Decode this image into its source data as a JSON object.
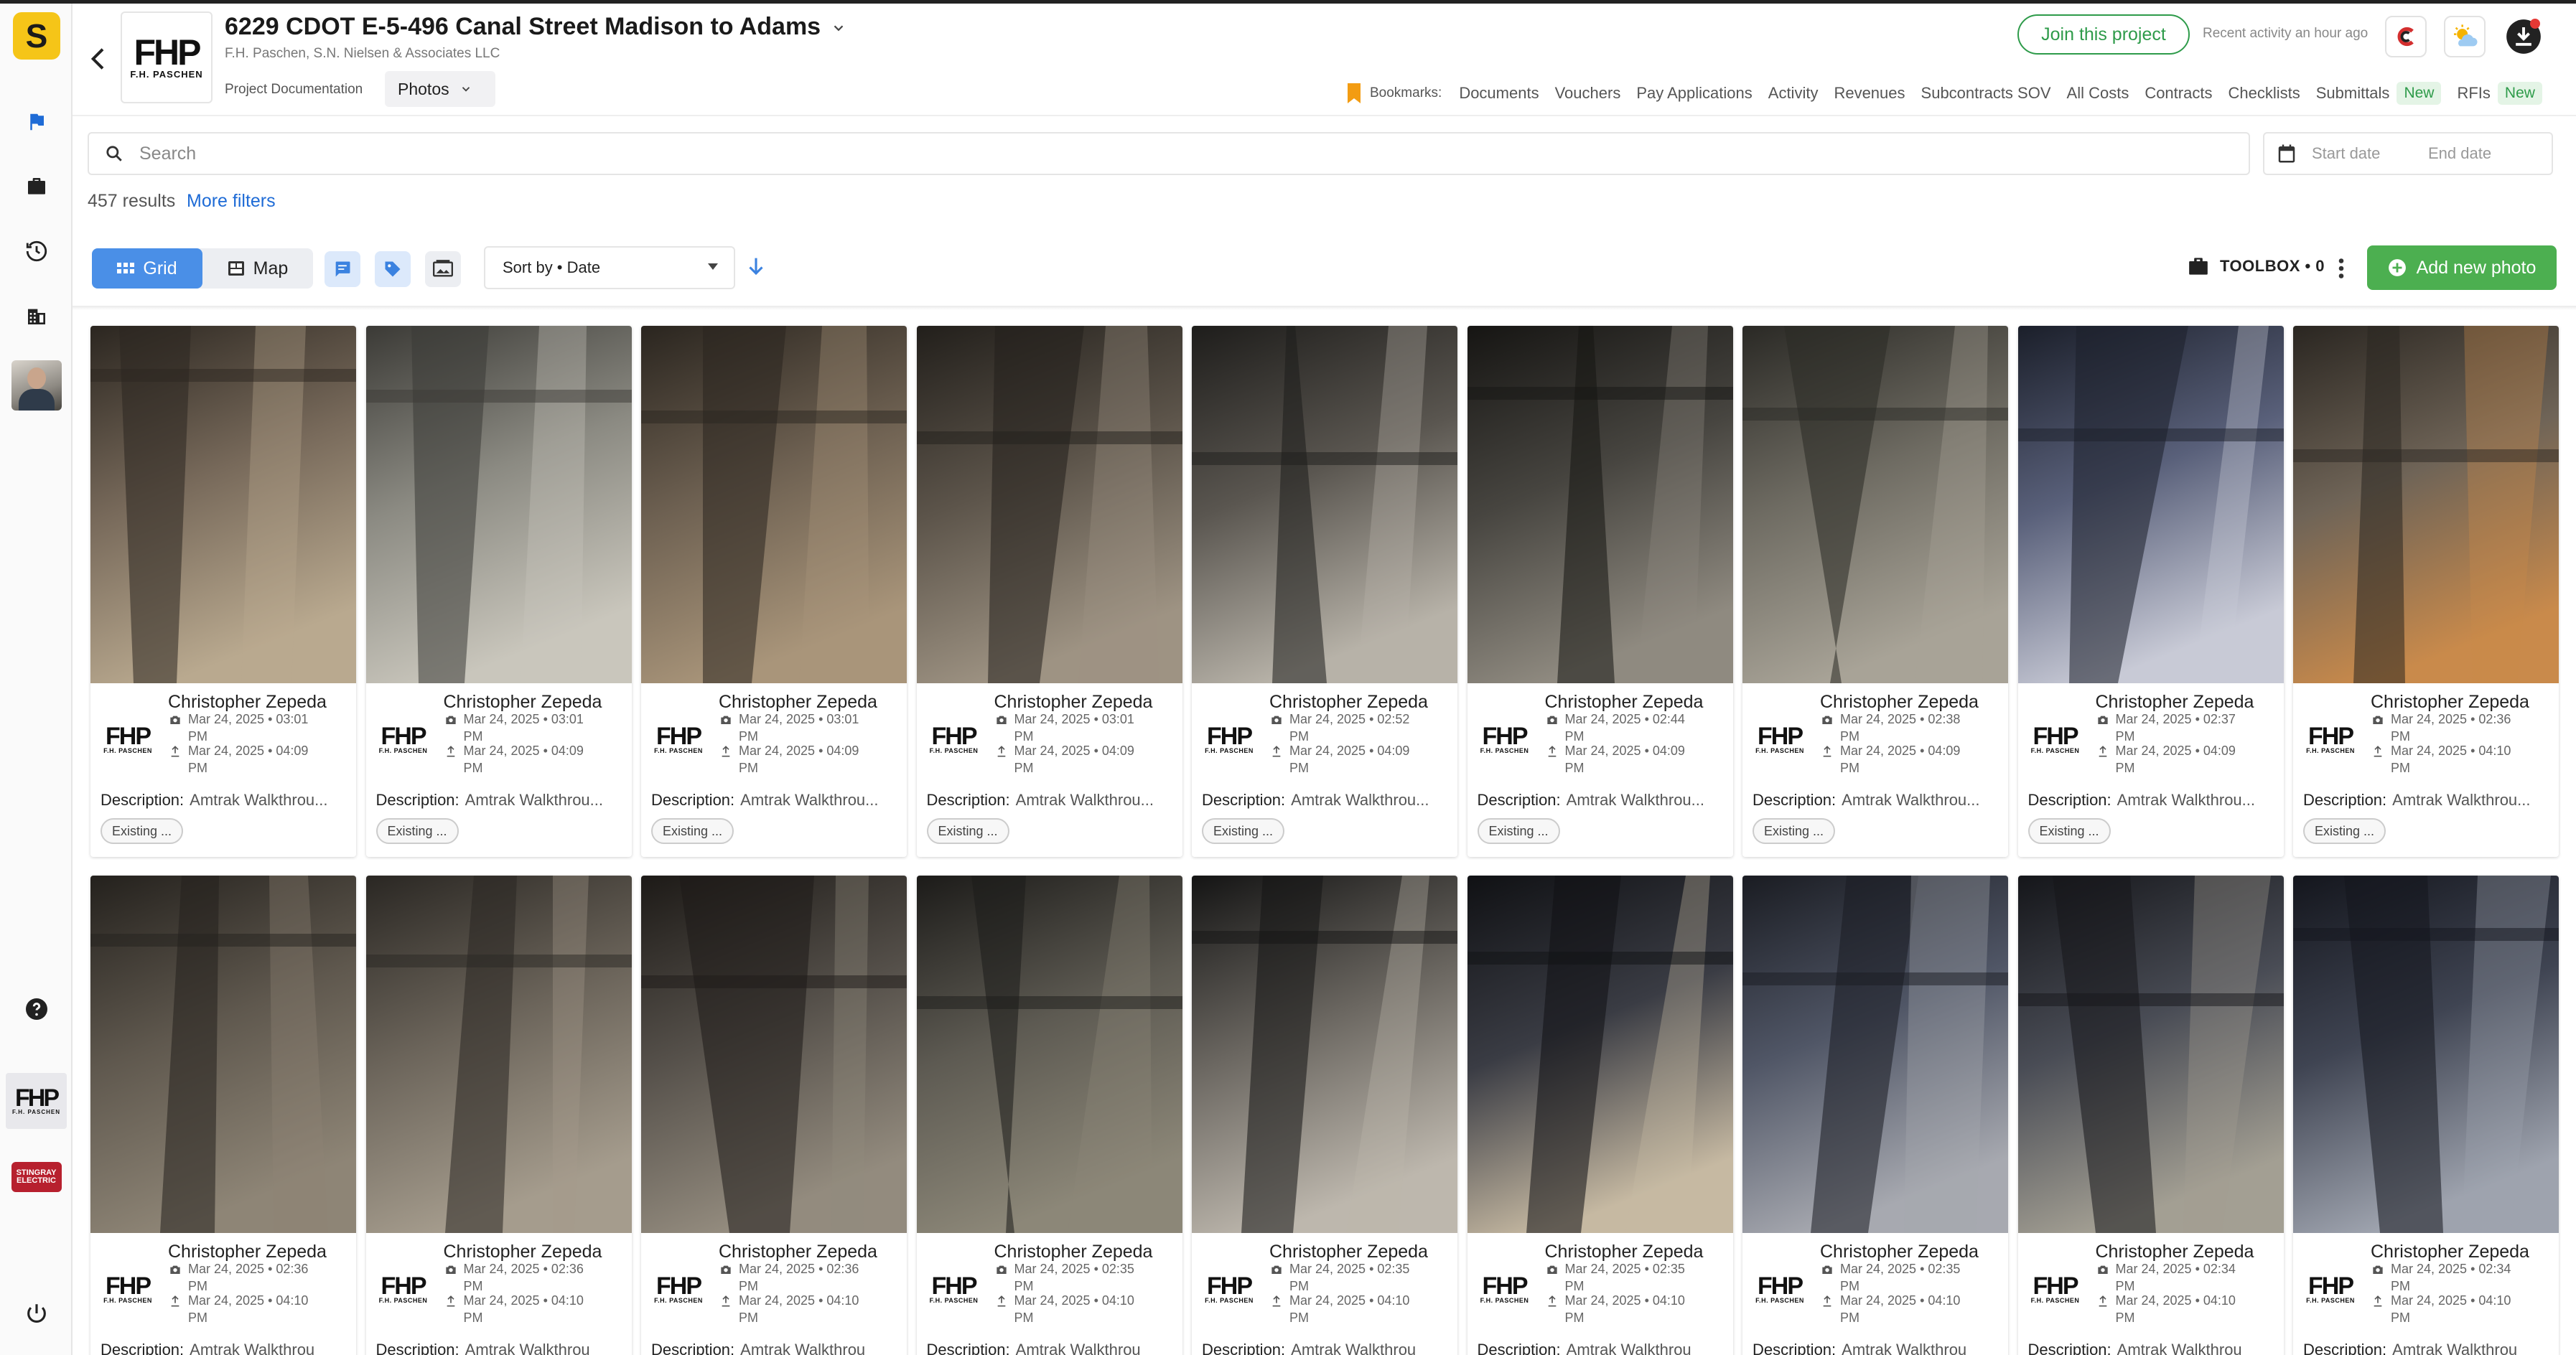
{
  "app": {
    "logo_letter": "S"
  },
  "project": {
    "title": "6229 CDOT E-5-496 Canal Street Madison to Adams",
    "subtitle": "F.H. Paschen, S.N. Nielsen & Associates LLC",
    "section": "Project Documentation",
    "view": "Photos",
    "logo_text": "FHP",
    "logo_sub": "F.H. PASCHEN"
  },
  "header": {
    "join_label": "Join this project",
    "recent_activity": "Recent activity an hour ago",
    "bookmarks_label": "Bookmarks:",
    "bookmarks": [
      {
        "label": "Documents"
      },
      {
        "label": "Vouchers"
      },
      {
        "label": "Pay Applications"
      },
      {
        "label": "Activity"
      },
      {
        "label": "Revenues"
      },
      {
        "label": "Subcontracts SOV"
      },
      {
        "label": "All Costs"
      },
      {
        "label": "Contracts"
      },
      {
        "label": "Checklists"
      },
      {
        "label": "Submittals",
        "badge": "New"
      },
      {
        "label": "RFIs",
        "badge": "New"
      }
    ]
  },
  "sidebar": {
    "items": [
      {
        "icon": "flag-icon"
      },
      {
        "icon": "briefcase-icon"
      },
      {
        "icon": "history-icon"
      },
      {
        "icon": "building-icon"
      },
      {
        "icon": "help-icon"
      },
      {
        "icon": "power-icon"
      }
    ],
    "company_stingray": "STINGRAY ELECTRIC"
  },
  "search": {
    "placeholder": "Search",
    "start_placeholder": "Start date",
    "end_placeholder": "End date"
  },
  "results": {
    "count_text": "457 results",
    "more_filters": "More filters"
  },
  "toolbar": {
    "grid_label": "Grid",
    "map_label": "Map",
    "sort_label": "Sort by • Date",
    "toolbox_label": "TOOLBOX • 0",
    "add_photo_label": "Add new photo"
  },
  "colors": {
    "accent": "#4a8fe7",
    "green": "#4caf50",
    "link": "#1e6bd6"
  },
  "photos": [
    {
      "author": "Christopher Zepeda",
      "taken": "Mar 24, 2025 • 03:01",
      "uploaded": "Mar 24, 2025 • 04:09",
      "desc_label": "Description:",
      "desc": "Amtrak Walkthrou...",
      "tag": "Existing ...",
      "time_suffix": "PM"
    },
    {
      "author": "Christopher Zepeda",
      "taken": "Mar 24, 2025 • 03:01",
      "uploaded": "Mar 24, 2025 • 04:09",
      "desc_label": "Description:",
      "desc": "Amtrak Walkthrou...",
      "tag": "Existing ...",
      "time_suffix": "PM"
    },
    {
      "author": "Christopher Zepeda",
      "taken": "Mar 24, 2025 • 03:01",
      "uploaded": "Mar 24, 2025 • 04:09",
      "desc_label": "Description:",
      "desc": "Amtrak Walkthrou...",
      "tag": "Existing ...",
      "time_suffix": "PM"
    },
    {
      "author": "Christopher Zepeda",
      "taken": "Mar 24, 2025 • 03:01",
      "uploaded": "Mar 24, 2025 • 04:09",
      "desc_label": "Description:",
      "desc": "Amtrak Walkthrou...",
      "tag": "Existing ...",
      "time_suffix": "PM"
    },
    {
      "author": "Christopher Zepeda",
      "taken": "Mar 24, 2025 • 02:52",
      "uploaded": "Mar 24, 2025 • 04:09",
      "desc_label": "Description:",
      "desc": "Amtrak Walkthrou...",
      "tag": "Existing ...",
      "time_suffix": "PM"
    },
    {
      "author": "Christopher Zepeda",
      "taken": "Mar 24, 2025 • 02:44",
      "uploaded": "Mar 24, 2025 • 04:09",
      "desc_label": "Description:",
      "desc": "Amtrak Walkthrou...",
      "tag": "Existing ...",
      "time_suffix": "PM"
    },
    {
      "author": "Christopher Zepeda",
      "taken": "Mar 24, 2025 • 02:38",
      "uploaded": "Mar 24, 2025 • 04:09",
      "desc_label": "Description:",
      "desc": "Amtrak Walkthrou...",
      "tag": "Existing ...",
      "time_suffix": "PM"
    },
    {
      "author": "Christopher Zepeda",
      "taken": "Mar 24, 2025 • 02:37",
      "uploaded": "Mar 24, 2025 • 04:09",
      "desc_label": "Description:",
      "desc": "Amtrak Walkthrou...",
      "tag": "Existing ...",
      "time_suffix": "PM"
    },
    {
      "author": "Christopher Zepeda",
      "taken": "Mar 24, 2025 • 02:36",
      "uploaded": "Mar 24, 2025 • 04:10",
      "desc_label": "Description:",
      "desc": "Amtrak Walkthrou...",
      "tag": "Existing ...",
      "time_suffix": "PM"
    },
    {
      "author": "Christopher Zepeda",
      "taken": "Mar 24, 2025 • 02:36",
      "uploaded": "Mar 24, 2025 • 04:10",
      "desc_label": "Description:",
      "desc": "Amtrak Walkthrou",
      "tag": "",
      "time_suffix": "PM"
    },
    {
      "author": "Christopher Zepeda",
      "taken": "Mar 24, 2025 • 02:36",
      "uploaded": "Mar 24, 2025 • 04:10",
      "desc_label": "Description:",
      "desc": "Amtrak Walkthrou",
      "tag": "",
      "time_suffix": "PM"
    },
    {
      "author": "Christopher Zepeda",
      "taken": "Mar 24, 2025 • 02:36",
      "uploaded": "Mar 24, 2025 • 04:10",
      "desc_label": "Description:",
      "desc": "Amtrak Walkthrou",
      "tag": "",
      "time_suffix": "PM"
    },
    {
      "author": "Christopher Zepeda",
      "taken": "Mar 24, 2025 • 02:35",
      "uploaded": "Mar 24, 2025 • 04:10",
      "desc_label": "Description:",
      "desc": "Amtrak Walkthrou",
      "tag": "",
      "time_suffix": "PM"
    },
    {
      "author": "Christopher Zepeda",
      "taken": "Mar 24, 2025 • 02:35",
      "uploaded": "Mar 24, 2025 • 04:10",
      "desc_label": "Description:",
      "desc": "Amtrak Walkthrou",
      "tag": "",
      "time_suffix": "PM"
    },
    {
      "author": "Christopher Zepeda",
      "taken": "Mar 24, 2025 • 02:35",
      "uploaded": "Mar 24, 2025 • 04:10",
      "desc_label": "Description:",
      "desc": "Amtrak Walkthrou",
      "tag": "",
      "time_suffix": "PM"
    },
    {
      "author": "Christopher Zepeda",
      "taken": "Mar 24, 2025 • 02:35",
      "uploaded": "Mar 24, 2025 • 04:10",
      "desc_label": "Description:",
      "desc": "Amtrak Walkthrou",
      "tag": "",
      "time_suffix": "PM"
    },
    {
      "author": "Christopher Zepeda",
      "taken": "Mar 24, 2025 • 02:34",
      "uploaded": "Mar 24, 2025 • 04:10",
      "desc_label": "Description:",
      "desc": "Amtrak Walkthrou",
      "tag": "",
      "time_suffix": "PM"
    },
    {
      "author": "Christopher Zepeda",
      "taken": "Mar 24, 2025 • 02:34",
      "uploaded": "Mar 24, 2025 • 04:10",
      "desc_label": "Description:",
      "desc": "Amtrak Walkthrou",
      "tag": "",
      "time_suffix": "PM"
    }
  ]
}
